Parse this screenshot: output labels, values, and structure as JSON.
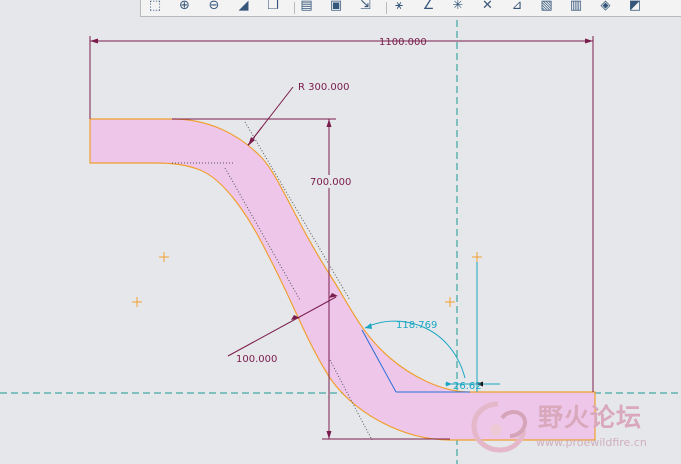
{
  "toolbar": {
    "buttons": [
      {
        "name": "zoom-window-icon",
        "glyph": "⬚"
      },
      {
        "name": "zoom-in-icon",
        "glyph": "⊕"
      },
      {
        "name": "zoom-out-icon",
        "glyph": "⊖"
      },
      {
        "name": "shading-icon",
        "glyph": "◢"
      },
      {
        "name": "view-cube-icon",
        "glyph": "❒"
      },
      {
        "name": "saved-views-icon",
        "glyph": "▤"
      },
      {
        "name": "screenshot-camera-icon",
        "glyph": "▣"
      },
      {
        "name": "insert-feature-icon",
        "glyph": "⇲"
      },
      {
        "name": "datum-axis-icon",
        "glyph": "⚹"
      },
      {
        "name": "sketch-constraint-icon",
        "glyph": "∠"
      },
      {
        "name": "point-display-icon",
        "glyph": "✳"
      },
      {
        "name": "coordinate-system-icon",
        "glyph": "✕"
      },
      {
        "name": "datum-plane-icon",
        "glyph": "⊿"
      },
      {
        "name": "display-style-icon",
        "glyph": "▧"
      },
      {
        "name": "model-tree-icon",
        "glyph": "▥"
      },
      {
        "name": "spin-center-icon",
        "glyph": "◈"
      },
      {
        "name": "orient-icon",
        "glyph": "◩"
      }
    ]
  },
  "sketch": {
    "profile_fill_color": "#edc6ea",
    "profile_edge_color": "#f0a030",
    "dimension_color": "#7a1c4c",
    "centerline_color": "#1a9a92",
    "angle_color": "#1aa7c2"
  },
  "dimensions": {
    "overall_width": "1100.000",
    "bend_radius": "R 300.000",
    "overall_height": "700.000",
    "wall_thickness": "100.000",
    "bend_angle": "118.769",
    "small_angle": "26.62"
  },
  "watermark": {
    "title": "野火论坛",
    "url": "www.proewildfire.cn"
  }
}
